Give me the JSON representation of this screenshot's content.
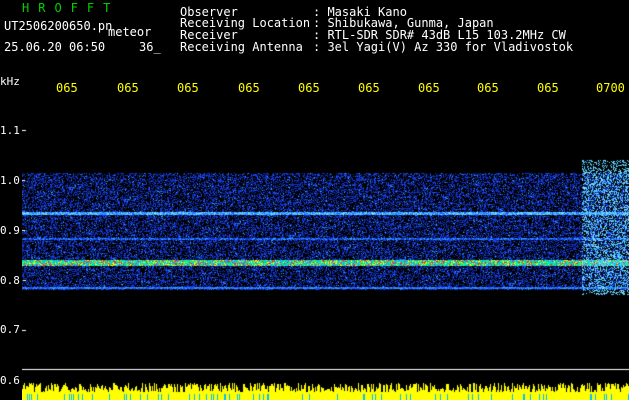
{
  "header": {
    "program": "HROFFT",
    "filename": "UT2506200650.pn",
    "tag": "meteor",
    "datetime": "25.06.20 06:50",
    "count": "36_",
    "fields": [
      {
        "label": "Observer",
        "value": ": Masaki Kano"
      },
      {
        "label": "Receiving Location",
        "value": ": Shibukawa, Gunma, Japan"
      },
      {
        "label": "Receiver",
        "value": ": RTL-SDR SDR# 43dB L15 103.2MHz CW"
      },
      {
        "label": "Receiving Antenna",
        "value": ": 3el Yagi(V) Az 330 for Vladivostok"
      }
    ]
  },
  "axis": {
    "y_unit": "kHz",
    "y_ticks": [
      "1.1",
      "1.0",
      "0.9",
      "0.8",
      "0.7",
      "0.6"
    ],
    "x_ticks": [
      "065",
      "065",
      "065",
      "065",
      "065",
      "065",
      "065",
      "065",
      "065",
      "0700"
    ]
  },
  "colors": {
    "header_green": "#00d000",
    "label_white": "#ffffff",
    "tick_yellow": "#ffff00",
    "noise_blue": "#2040ff",
    "signal_red": "#ff2020"
  }
}
